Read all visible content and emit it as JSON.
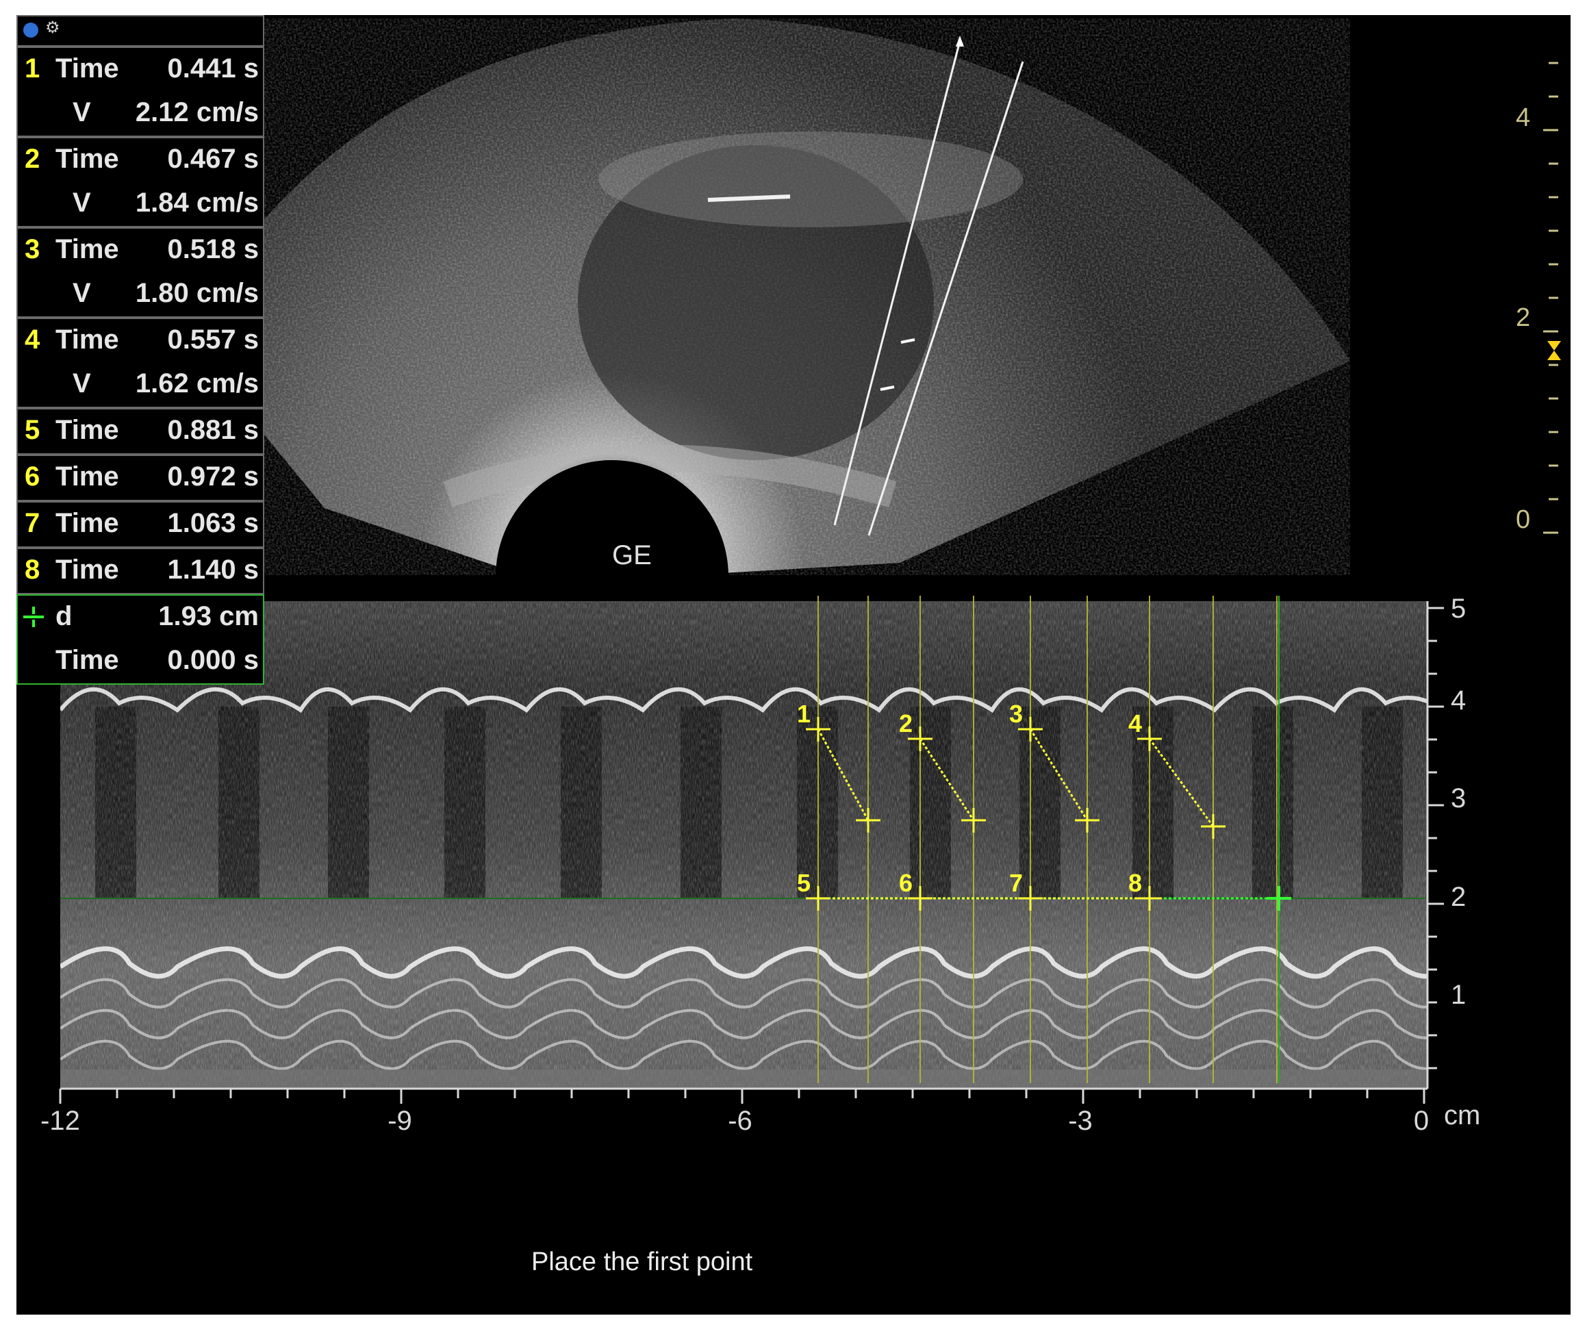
{
  "measurements": [
    {
      "num": "1",
      "rows": [
        {
          "label": "Time",
          "value": "0.441 s"
        },
        {
          "label": "V",
          "value": "2.12 cm/s"
        }
      ]
    },
    {
      "num": "2",
      "rows": [
        {
          "label": "Time",
          "value": "0.467 s"
        },
        {
          "label": "V",
          "value": "1.84 cm/s"
        }
      ]
    },
    {
      "num": "3",
      "rows": [
        {
          "label": "Time",
          "value": "0.518 s"
        },
        {
          "label": "V",
          "value": "1.80 cm/s"
        }
      ]
    },
    {
      "num": "4",
      "rows": [
        {
          "label": "Time",
          "value": "0.557 s"
        },
        {
          "label": "V",
          "value": "1.62 cm/s"
        }
      ]
    },
    {
      "num": "5",
      "rows": [
        {
          "label": "Time",
          "value": "0.881 s"
        }
      ]
    },
    {
      "num": "6",
      "rows": [
        {
          "label": "Time",
          "value": "0.972 s"
        }
      ]
    },
    {
      "num": "7",
      "rows": [
        {
          "label": "Time",
          "value": "1.063 s"
        }
      ]
    },
    {
      "num": "8",
      "rows": [
        {
          "label": "Time",
          "value": "1.140 s"
        }
      ]
    }
  ],
  "active_measurement": {
    "rows": [
      {
        "label": "d",
        "value": "1.93 cm"
      },
      {
        "label": "Time",
        "value": "0.000 s"
      }
    ]
  },
  "brand_label": "GE",
  "bmode_depth_ticks": [
    "4",
    "2",
    "0"
  ],
  "mmode_depth_ticks": [
    "5",
    "4",
    "3",
    "2",
    "1"
  ],
  "mmode_time_ticks": [
    "-12",
    "-9",
    "-6",
    "-3",
    "0"
  ],
  "mmode_unit": "cm",
  "marker_labels": [
    "1",
    "2",
    "3",
    "4",
    "5",
    "6",
    "7",
    "8"
  ],
  "status_text": "Place the first point",
  "colors": {
    "marker": "#ffff33",
    "cursor": "#33ff33",
    "panel_border": "#6a6a6a",
    "active_border": "#2fb52f"
  }
}
